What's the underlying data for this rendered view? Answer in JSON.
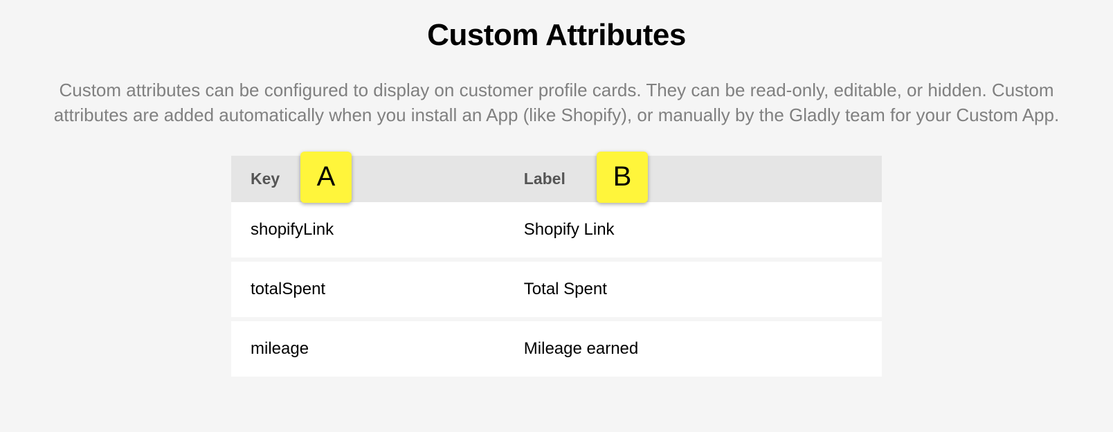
{
  "title": "Custom Attributes",
  "description": "Custom attributes can be configured to display on customer profile cards. They can be read-only, editable, or hidden. Custom attributes are added automatically when you install an App (like Shopify), or manually by the Gladly team for your Custom App.",
  "table": {
    "headers": {
      "key": "Key",
      "label": "Label"
    },
    "rows": [
      {
        "key": "shopifyLink",
        "label": "Shopify Link"
      },
      {
        "key": "totalSpent",
        "label": "Total Spent"
      },
      {
        "key": "mileage",
        "label": "Mileage earned"
      }
    ]
  },
  "annotations": {
    "a": "A",
    "b": "B"
  }
}
